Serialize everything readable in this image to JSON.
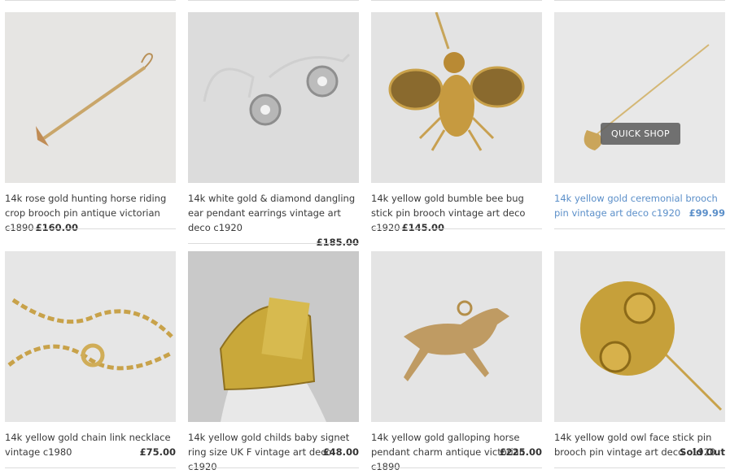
{
  "products": [
    {
      "title": "14k rose gold hunting horse riding crop brooch pin antique victorian c1890",
      "price": "£160.00"
    },
    {
      "title": "14k white gold & diamond dangling ear pendant earrings vintage art deco c1920",
      "price": "£185.00"
    },
    {
      "title": "14k yellow gold bumble bee bug stick pin brooch vintage art deco c1920",
      "price": "£145.00"
    },
    {
      "title": "14k yellow gold ceremonial brooch pin vintage art deco c1920",
      "price": "£99.99",
      "overlay": "QUICK SHOP"
    },
    {
      "title": "14k yellow gold chain link necklace vintage c1980",
      "price": "£75.00"
    },
    {
      "title": "14k yellow gold childs baby signet ring size UK F vintage art deco c1920",
      "price": "£48.00"
    },
    {
      "title": "14k yellow gold galloping horse pendant charm antique victorian c1890",
      "price": "£225.00"
    },
    {
      "title": "14k yellow gold owl face stick pin brooch pin vintage art deco c1920",
      "price": "Sold Out"
    }
  ],
  "colors": {
    "hover_link": "#5b8fc9",
    "divider": "#dcdcdc"
  }
}
